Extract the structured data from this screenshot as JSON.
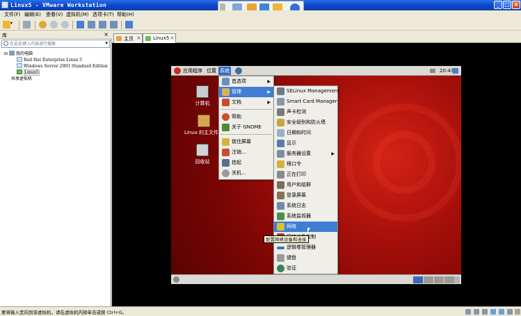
{
  "window": {
    "title": "Linux5 - VMware Workstation"
  },
  "menubar": {
    "items": [
      "文件(F)",
      "编辑(E)",
      "查看(V)",
      "虚拟机(M)",
      "选项卡(T)",
      "帮助(H)"
    ]
  },
  "library": {
    "title": "库",
    "search_placeholder": "在此处键入内容进行搜索",
    "root": "我的电脑",
    "vms": [
      "Red Hat Enterprise Linux 5",
      "Windows Server 2003 Standard Edition",
      "Linux5"
    ],
    "shared": "共享虚拟机"
  },
  "tabs": [
    {
      "label": "主页"
    },
    {
      "label": "Linux5"
    }
  ],
  "guest": {
    "top_menus": [
      "应用程序",
      "位置",
      "系统"
    ],
    "clock": "20:43",
    "desktop_icons": [
      "计算机",
      "Linux 的主文件夹",
      "回收站"
    ],
    "system_menu": [
      "首选项",
      "管理",
      "文档",
      "帮助",
      "关于 GNOME",
      "锁住屏幕",
      "注销...",
      "挂起",
      "关机..."
    ],
    "admin_menu": [
      "SELinux Management",
      "Smart Card Manager",
      "声卡检测",
      "安全级别和防火墙",
      "日期和时间",
      "显示",
      "服务器设置",
      "根口令",
      "正在打印",
      "用户和组群",
      "登录屏幕",
      "系统日志",
      "系统监视器",
      "网络",
      "网络设备控制",
      "逻辑卷管理器",
      "键盘",
      "验证"
    ],
    "tooltip": "配置网络设备和连接"
  },
  "statusbar": {
    "text": "要将输入定向到该虚拟机，请在虚拟机内部单击或按 Ctrl+G。"
  },
  "colors": {
    "titlebar": "#0a46c8",
    "highlight": "#3f7ed3",
    "desktop": "#a50f0a"
  }
}
